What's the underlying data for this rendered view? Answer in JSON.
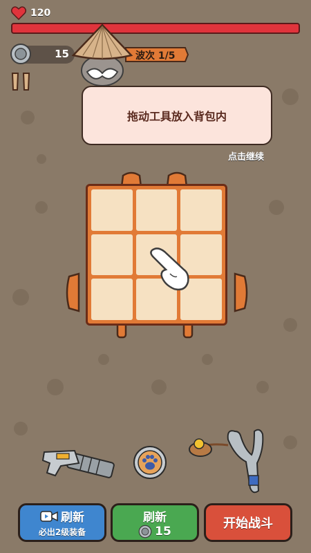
{
  "hud": {
    "health_value": "120",
    "coins": "15",
    "wave_label": "波次 1/5"
  },
  "tutorial": {
    "instruction": "拖动工具放入背包内",
    "continue_hint": "点击继续"
  },
  "backpack": {
    "rows": 3,
    "cols": 3
  },
  "items": {
    "weapon_1": "gatling-gun-icon",
    "weapon_2": "paw-token-icon",
    "weapon_3": "slingshot-icon"
  },
  "buttons": {
    "refresh_ad_label": "刷新",
    "refresh_ad_sub": "必出2级装备",
    "refresh_coin_label": "刷新",
    "refresh_coin_cost": "15",
    "start_battle_label": "开始战斗"
  },
  "colors": {
    "background": "#8a7a68",
    "health_bar": "#e0343c",
    "backpack_frame": "#e17a36",
    "cell": "#f6e1c2",
    "btn_blue": "#3f86cf",
    "btn_green": "#4aa851",
    "btn_red": "#d9503b"
  }
}
